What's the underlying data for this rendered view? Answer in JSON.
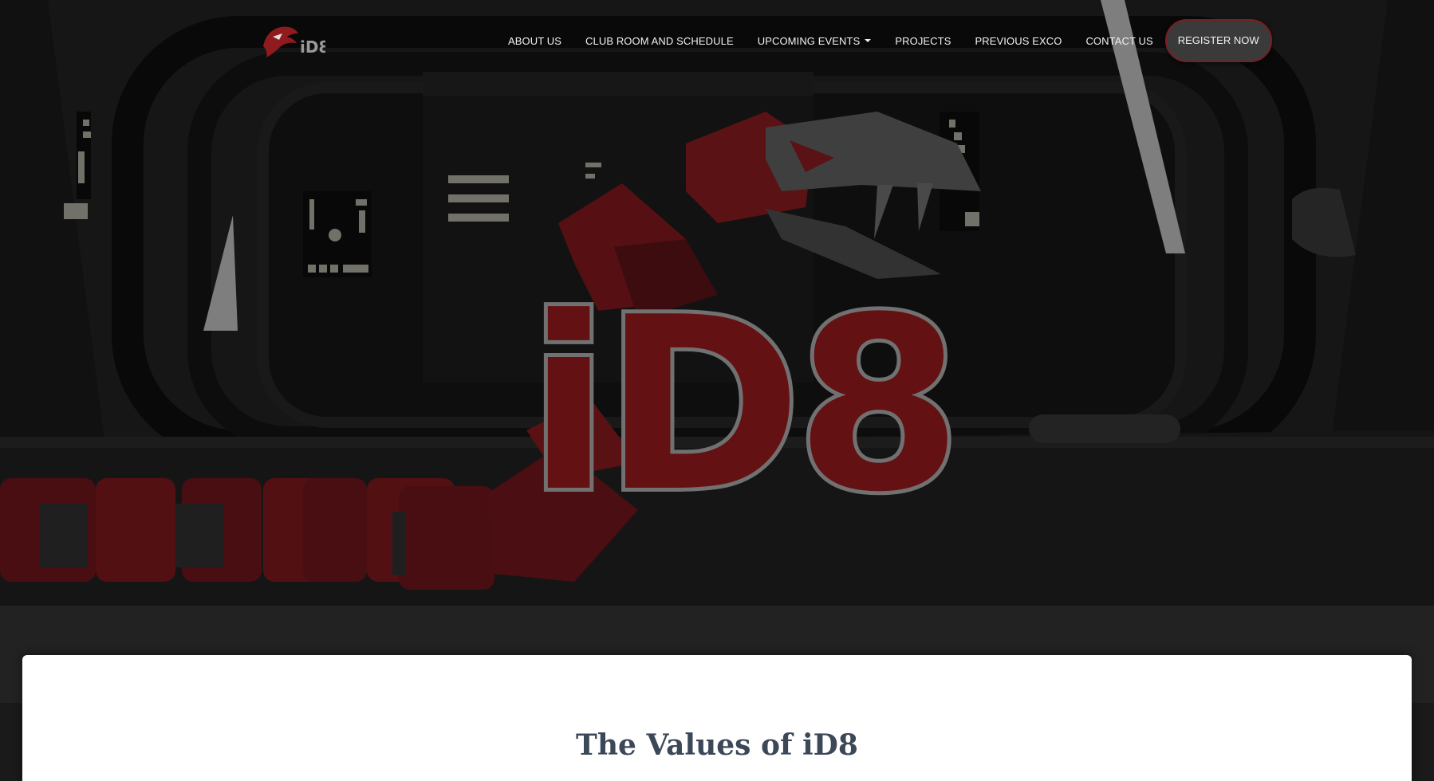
{
  "brand": {
    "logo_text": "iD8",
    "logo_icon": "snake-head-icon",
    "hero_logo_text": "iD8",
    "accent_color": "#7b1518",
    "logo_outline_color": "#8a8a8a"
  },
  "nav": {
    "items": [
      {
        "label": "ABOUT US"
      },
      {
        "label": "CLUB ROOM AND SCHEDULE"
      },
      {
        "label": "UPCOMING EVENTS",
        "dropdown": true
      },
      {
        "label": "PROJECTS"
      },
      {
        "label": "PREVIOUS EXCO"
      },
      {
        "label": "CONTACT US"
      }
    ],
    "cta_label": "REGISTER NOW",
    "caret_icon": "caret-down-icon"
  },
  "main": {
    "section_title": "The Values of iD8"
  }
}
